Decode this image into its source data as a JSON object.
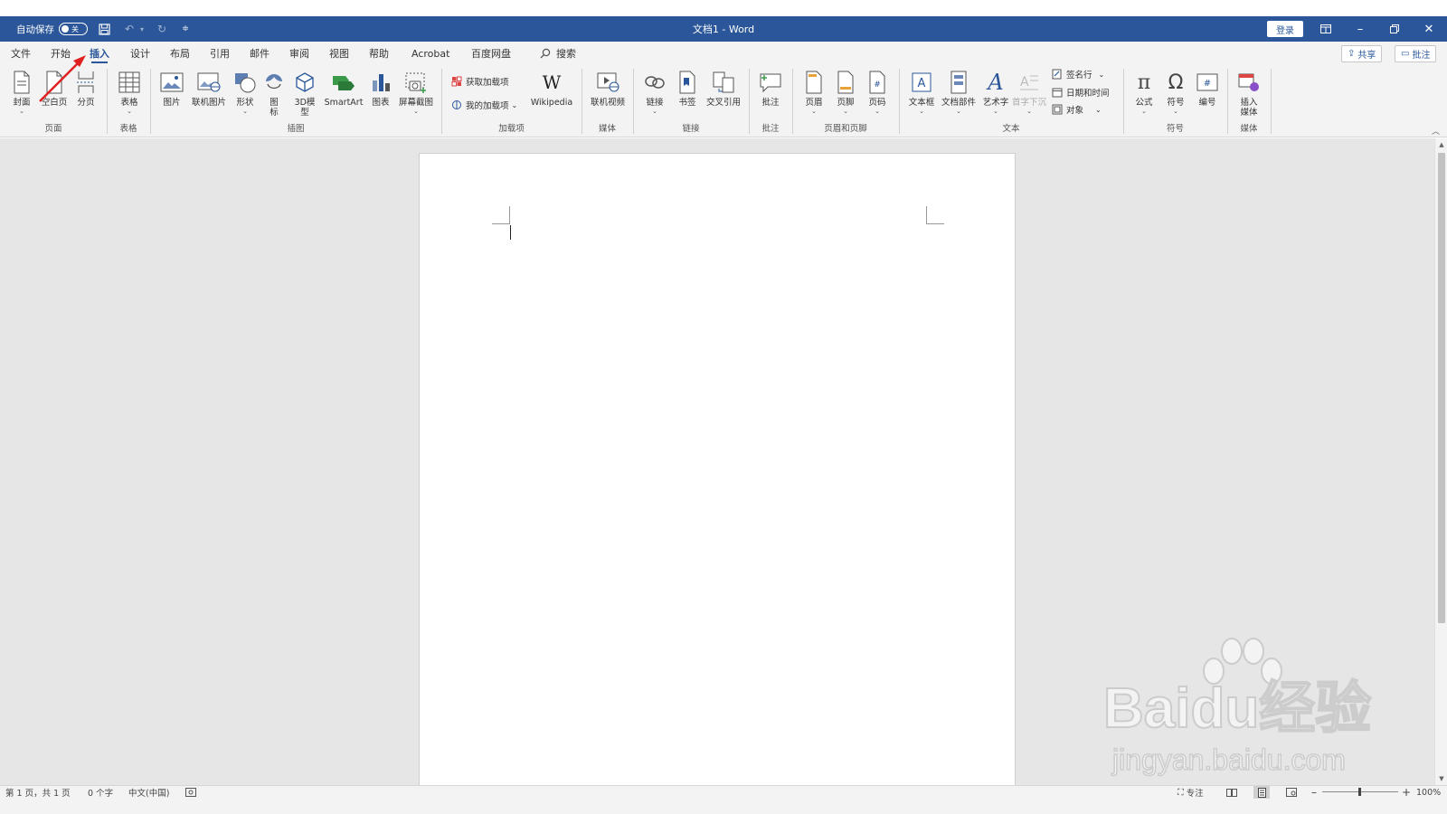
{
  "titlebar": {
    "autosave_label": "自动保存",
    "autosave_state": "关",
    "doc_title": "文档1 - Word",
    "login_label": "登录",
    "icons": [
      "save-icon",
      "undo-icon",
      "redo-icon",
      "customize-qat-icon"
    ]
  },
  "tabs": [
    "文件",
    "开始",
    "插入",
    "设计",
    "布局",
    "引用",
    "邮件",
    "审阅",
    "视图",
    "帮助",
    "Acrobat",
    "百度网盘"
  ],
  "active_tab": "插入",
  "search_label": "搜索",
  "share_label": "共享",
  "comments_label": "批注",
  "ribbon": {
    "pages": {
      "label": "页面",
      "cover": "封面",
      "blank": "空白页",
      "break": "分页"
    },
    "tables": {
      "label": "表格",
      "table": "表格"
    },
    "illustrations": {
      "label": "插图",
      "picture": "图片",
      "online_picture": "联机图片",
      "shapes": "形状",
      "icons": "图标",
      "model3d": "3D模型",
      "smartart": "SmartArt",
      "chart": "图表",
      "screenshot": "屏幕截图"
    },
    "addins": {
      "label": "加载项",
      "get": "获取加载项",
      "my": "我的加载项",
      "wikipedia": "Wikipedia"
    },
    "media": {
      "label": "媒体",
      "online_video": "联机视频"
    },
    "links": {
      "label": "链接",
      "link": "链接",
      "bookmark": "书签",
      "cross_ref": "交叉引用"
    },
    "comments": {
      "label": "批注",
      "comment": "批注"
    },
    "header_footer": {
      "label": "页眉和页脚",
      "header": "页眉",
      "footer": "页脚",
      "page_number": "页码"
    },
    "text": {
      "label": "文本",
      "textbox": "文本框",
      "quick_parts": "文档部件",
      "wordart": "艺术字",
      "dropcap": "首字下沉",
      "signature": "签名行",
      "datetime": "日期和时间",
      "object": "对象"
    },
    "symbols": {
      "label": "符号",
      "equation": "公式",
      "symbol": "符号",
      "numbering": "编号"
    },
    "media2": {
      "label": "媒体",
      "insert_media": "插入媒体"
    }
  },
  "status": {
    "page": "第 1 页，共 1 页",
    "words": "0 个字",
    "language": "中文(中国)",
    "focus": "专注",
    "zoom": "100%"
  },
  "watermark": {
    "logo": "Baidu经验",
    "url": "jingyan.baidu.com"
  },
  "colors": {
    "accent": "#2b579a",
    "ribbon_bg": "#f3f3f3",
    "canvas_bg": "#e6e6e6",
    "annotation": "#e02020"
  }
}
